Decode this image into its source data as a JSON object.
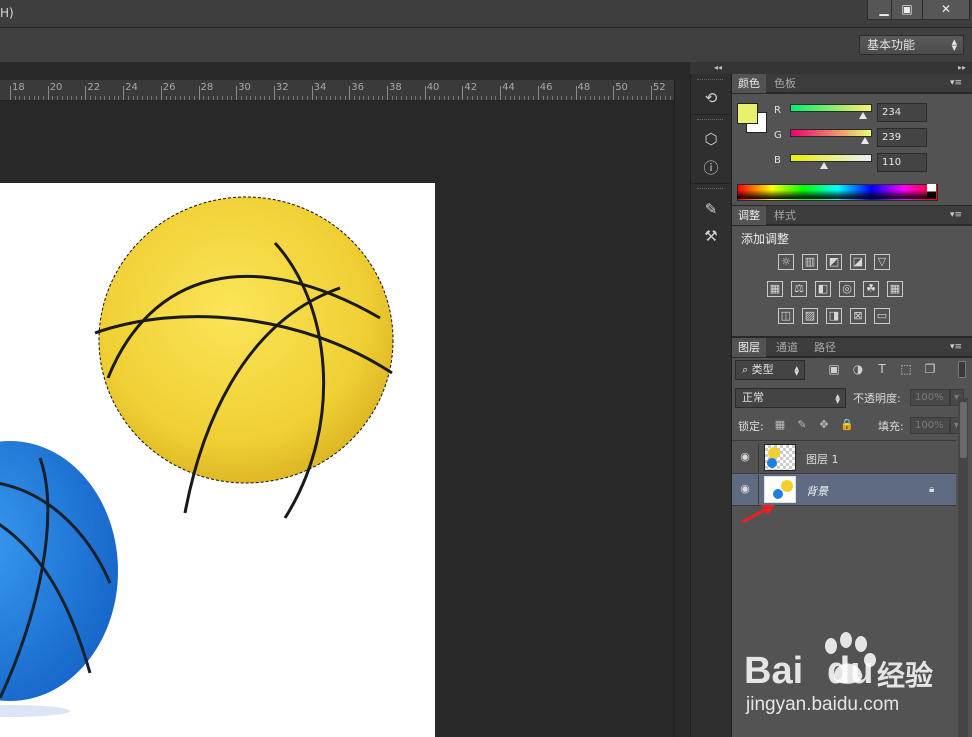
{
  "titlebar": {
    "menu_fragment": "H)",
    "minimize_glyph": "▁",
    "maximize_glyph": "▣",
    "close_glyph": "✕"
  },
  "options": {
    "workspace": "基本功能"
  },
  "panel_strip": {
    "collapse_left": "◂◂",
    "collapse_right": "▸▸"
  },
  "ruler": {
    "labels": [
      "18",
      "20",
      "22",
      "24",
      "26",
      "28",
      "30",
      "32",
      "34",
      "36",
      "38",
      "40",
      "42",
      "44",
      "46",
      "48",
      "50",
      "52"
    ]
  },
  "tools": [
    {
      "name": "history-icon",
      "glyph": "⟲"
    },
    {
      "name": "3d-icon",
      "glyph": "⬡"
    },
    {
      "name": "info-icon",
      "glyph": "ⓘ"
    },
    {
      "name": "brush-presets-icon",
      "glyph": "✎"
    },
    {
      "name": "tool-presets-icon",
      "glyph": "⚒"
    }
  ],
  "color_panel": {
    "tabs": [
      "颜色",
      "色板"
    ],
    "foreground": "#eaef6e",
    "background": "#ffffff",
    "channels": [
      {
        "label": "R",
        "value": "234",
        "level": 0.918
      },
      {
        "label": "G",
        "value": "239",
        "level": 0.937
      },
      {
        "label": "B",
        "value": "110",
        "level": 0.431
      }
    ]
  },
  "adjust_panel": {
    "tabs": [
      "调整",
      "样式"
    ],
    "title": "添加调整",
    "rows": [
      [
        "☼",
        "▥",
        "◩",
        "◪",
        "▽"
      ],
      [
        "▦",
        "⚖",
        "◧",
        "◎",
        "☘",
        "▦"
      ],
      [
        "◫",
        "▨",
        "◨",
        "⊠",
        "▭"
      ]
    ]
  },
  "layers_panel": {
    "tabs": [
      "图层",
      "通道",
      "路径"
    ],
    "filter_label": "类型",
    "filter_icon": "⌕",
    "filter_icons": [
      "▣",
      "◑",
      "T",
      "⬚",
      "❐"
    ],
    "blend_mode": "正常",
    "opacity_label": "不透明度:",
    "opacity_value": "100%",
    "lock_label": "锁定:",
    "lock_icons": [
      "▦",
      "✎",
      "✥",
      "🔒"
    ],
    "fill_label": "填充:",
    "fill_value": "100%",
    "layers": [
      {
        "name": "图层 1",
        "selected": false,
        "locked": false
      },
      {
        "name": "背景",
        "selected": true,
        "locked": true
      }
    ]
  },
  "watermark": {
    "brand": "Bai",
    "brand2": "du",
    "suffix": "经验",
    "url": "jingyan.baidu.com"
  },
  "colors": {
    "accent_arrow": "#e8201e",
    "yellow_ball": "#f3d23a",
    "blue_ball": "#1f7fe0"
  }
}
